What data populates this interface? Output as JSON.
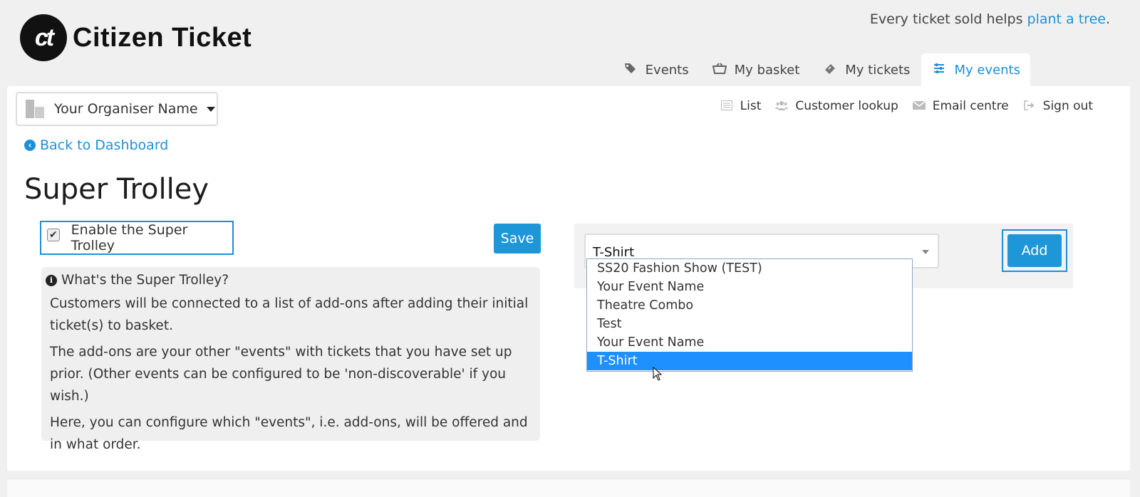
{
  "header": {
    "logo_mark": "ct",
    "logo_text": "Citizen Ticket",
    "tagline_prefix": "Every ticket sold helps ",
    "tagline_link": "plant a tree",
    "tagline_suffix": "."
  },
  "main_nav": {
    "tabs": [
      {
        "label": "Events",
        "icon": "tags-icon"
      },
      {
        "label": "My basket",
        "icon": "basket-icon"
      },
      {
        "label": "My tickets",
        "icon": "ticket-icon"
      },
      {
        "label": "My events",
        "icon": "sliders-icon",
        "active": true
      }
    ]
  },
  "organiser": {
    "name": "Your Organiser Name"
  },
  "sub_nav": {
    "items": [
      {
        "label": "List",
        "icon": "list-icon"
      },
      {
        "label": "Customer lookup",
        "icon": "users-icon"
      },
      {
        "label": "Email centre",
        "icon": "envelope-icon"
      },
      {
        "label": "Sign out",
        "icon": "sign-out-icon"
      }
    ]
  },
  "back_link": "Back to Dashboard",
  "page_title": "Super Trolley",
  "enable": {
    "label": "Enable the Super Trolley",
    "checked": true
  },
  "save_label": "Save",
  "info": {
    "title": "What's the Super Trolley?",
    "p1": "Customers will be connected to a list of add-ons after adding their initial ticket(s) to basket.",
    "p2": "The add-ons are your other \"events\" with tickets that you have set up prior. (Other events can be configured to be 'non-discoverable' if you wish.)",
    "p3": "Here, you can configure which \"events\", i.e. add-ons, will be offered and in what order."
  },
  "event_select": {
    "value": "T-Shirt",
    "options": [
      "SS20 Fashion Show (TEST)",
      "Your Event Name",
      "Theatre Combo",
      "Test",
      "Your Event Name",
      "T-Shirt"
    ],
    "selected_index": 5
  },
  "add_label": "Add",
  "colors": {
    "accent": "#1e90d6",
    "button": "#1e97d8",
    "selected": "#1e90ff"
  }
}
